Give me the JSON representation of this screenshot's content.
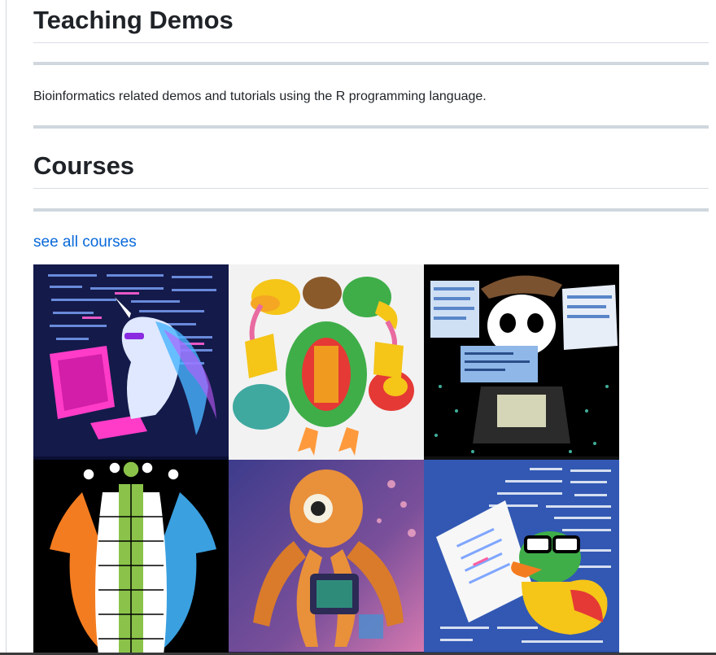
{
  "sections": {
    "teaching_demos": {
      "title": "Teaching Demos",
      "description": "Bioinformatics related demos and tutorials using the R programming language."
    },
    "courses": {
      "title": "Courses",
      "see_all_link": "see all courses"
    }
  },
  "course_images": [
    {
      "subject": "unicorn-coding-icon",
      "palette": [
        "#141a4a",
        "#ff3cc8",
        "#7fd4ff"
      ]
    },
    {
      "subject": "three-headed-bird-icon",
      "palette": [
        "#f2f2f2",
        "#3fae49",
        "#f5c518"
      ]
    },
    {
      "subject": "panda-cowboy-icon",
      "palette": [
        "#000000",
        "#2b2b2b",
        "#8fb7e8"
      ]
    },
    {
      "subject": "geometric-creature-icon",
      "palette": [
        "#000000",
        "#f47c20",
        "#3aa0e0"
      ]
    },
    {
      "subject": "octopus-robot-icon",
      "palette": [
        "#4a3f8f",
        "#e9903a",
        "#2b2b55"
      ]
    },
    {
      "subject": "duck-with-code-icon",
      "palette": [
        "#3258b3",
        "#3fae49",
        "#f5c518"
      ]
    }
  ]
}
